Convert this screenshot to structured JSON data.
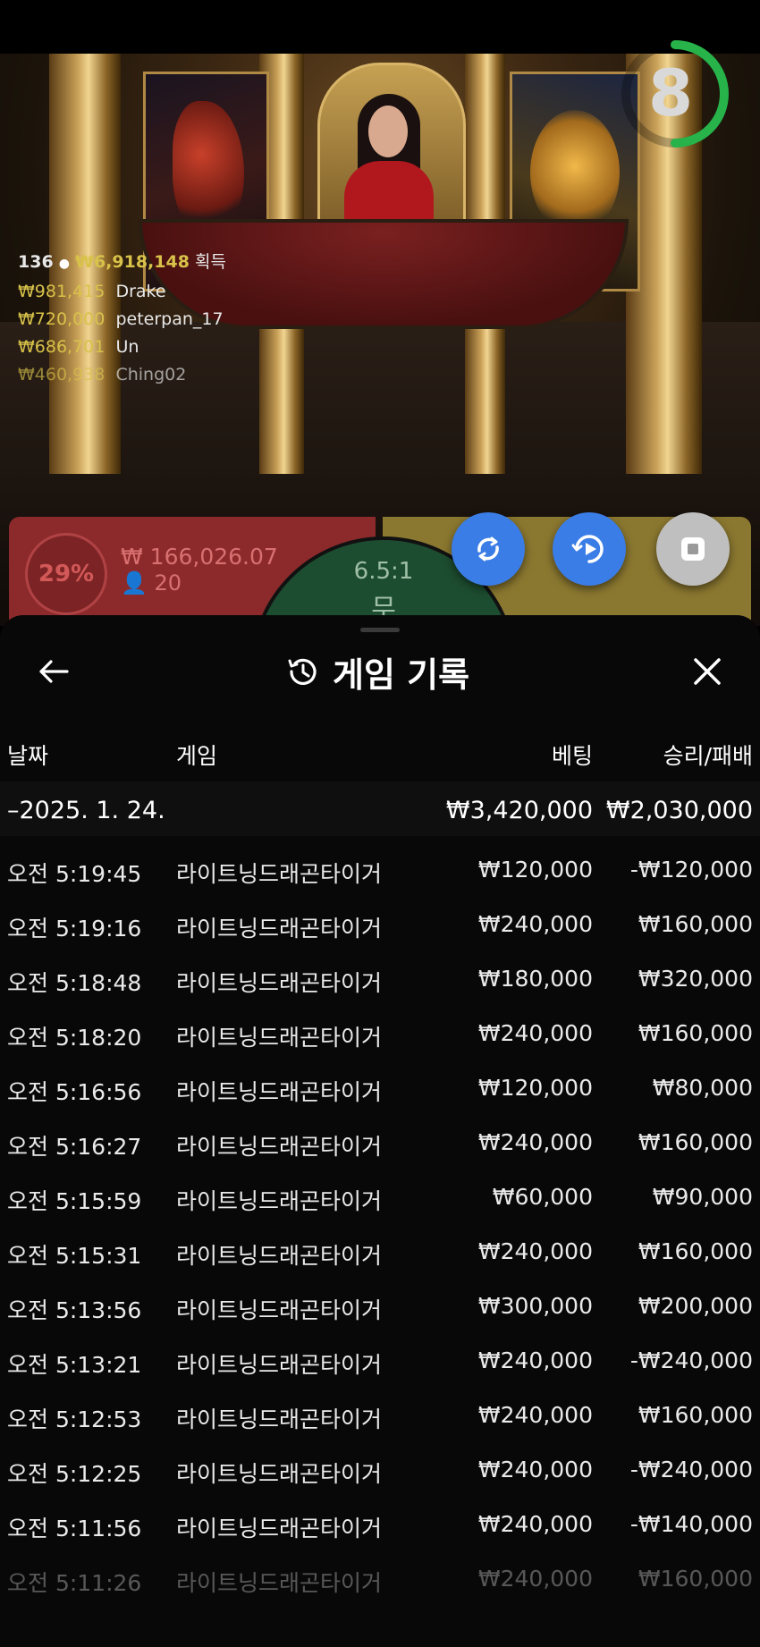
{
  "timer": {
    "value": "8"
  },
  "chat": {
    "count": "136",
    "total": "₩6,918,148",
    "won_label": "획득",
    "entries": [
      {
        "amount": "₩981,415",
        "name": "Drake"
      },
      {
        "amount": "₩720,000",
        "name": "peterpan_17"
      },
      {
        "amount": "₩686,701",
        "name": "Un"
      },
      {
        "amount": "₩460,938",
        "name": "Ching02"
      }
    ]
  },
  "bets": {
    "dragon_percent": "29%",
    "dragon_amount": "₩ 166,026.07",
    "dragon_players": "20",
    "tie_odds": "6.5:1",
    "tie_label": "무"
  },
  "history": {
    "title": "게임 기록",
    "columns": {
      "date": "날짜",
      "game": "게임",
      "bet": "베팅",
      "result": "승리/패배"
    },
    "summary": {
      "date": "–2025. 1. 24.",
      "bet": "₩3,420,000",
      "result": "₩2,030,000"
    },
    "rows": [
      {
        "time": "오전 5:19:45",
        "game": "라이트닝드래곤타이거",
        "bet": "₩120,000",
        "result": "-₩120,000"
      },
      {
        "time": "오전 5:19:16",
        "game": "라이트닝드래곤타이거",
        "bet": "₩240,000",
        "result": "₩160,000"
      },
      {
        "time": "오전 5:18:48",
        "game": "라이트닝드래곤타이거",
        "bet": "₩180,000",
        "result": "₩320,000"
      },
      {
        "time": "오전 5:18:20",
        "game": "라이트닝드래곤타이거",
        "bet": "₩240,000",
        "result": "₩160,000"
      },
      {
        "time": "오전 5:16:56",
        "game": "라이트닝드래곤타이거",
        "bet": "₩120,000",
        "result": "₩80,000"
      },
      {
        "time": "오전 5:16:27",
        "game": "라이트닝드래곤타이거",
        "bet": "₩240,000",
        "result": "₩160,000"
      },
      {
        "time": "오전 5:15:59",
        "game": "라이트닝드래곤타이거",
        "bet": "₩60,000",
        "result": "₩90,000"
      },
      {
        "time": "오전 5:15:31",
        "game": "라이트닝드래곤타이거",
        "bet": "₩240,000",
        "result": "₩160,000"
      },
      {
        "time": "오전 5:13:56",
        "game": "라이트닝드래곤타이거",
        "bet": "₩300,000",
        "result": "₩200,000"
      },
      {
        "time": "오전 5:13:21",
        "game": "라이트닝드래곤타이거",
        "bet": "₩240,000",
        "result": "-₩240,000"
      },
      {
        "time": "오전 5:12:53",
        "game": "라이트닝드래곤타이거",
        "bet": "₩240,000",
        "result": "₩160,000"
      },
      {
        "time": "오전 5:12:25",
        "game": "라이트닝드래곤타이거",
        "bet": "₩240,000",
        "result": "-₩240,000"
      },
      {
        "time": "오전 5:11:56",
        "game": "라이트닝드래곤타이거",
        "bet": "₩240,000",
        "result": "-₩140,000"
      },
      {
        "time": "오전 5:11:26",
        "game": "라이트닝드래곤타이거",
        "bet": "₩240,000",
        "result": "₩160,000"
      }
    ]
  }
}
